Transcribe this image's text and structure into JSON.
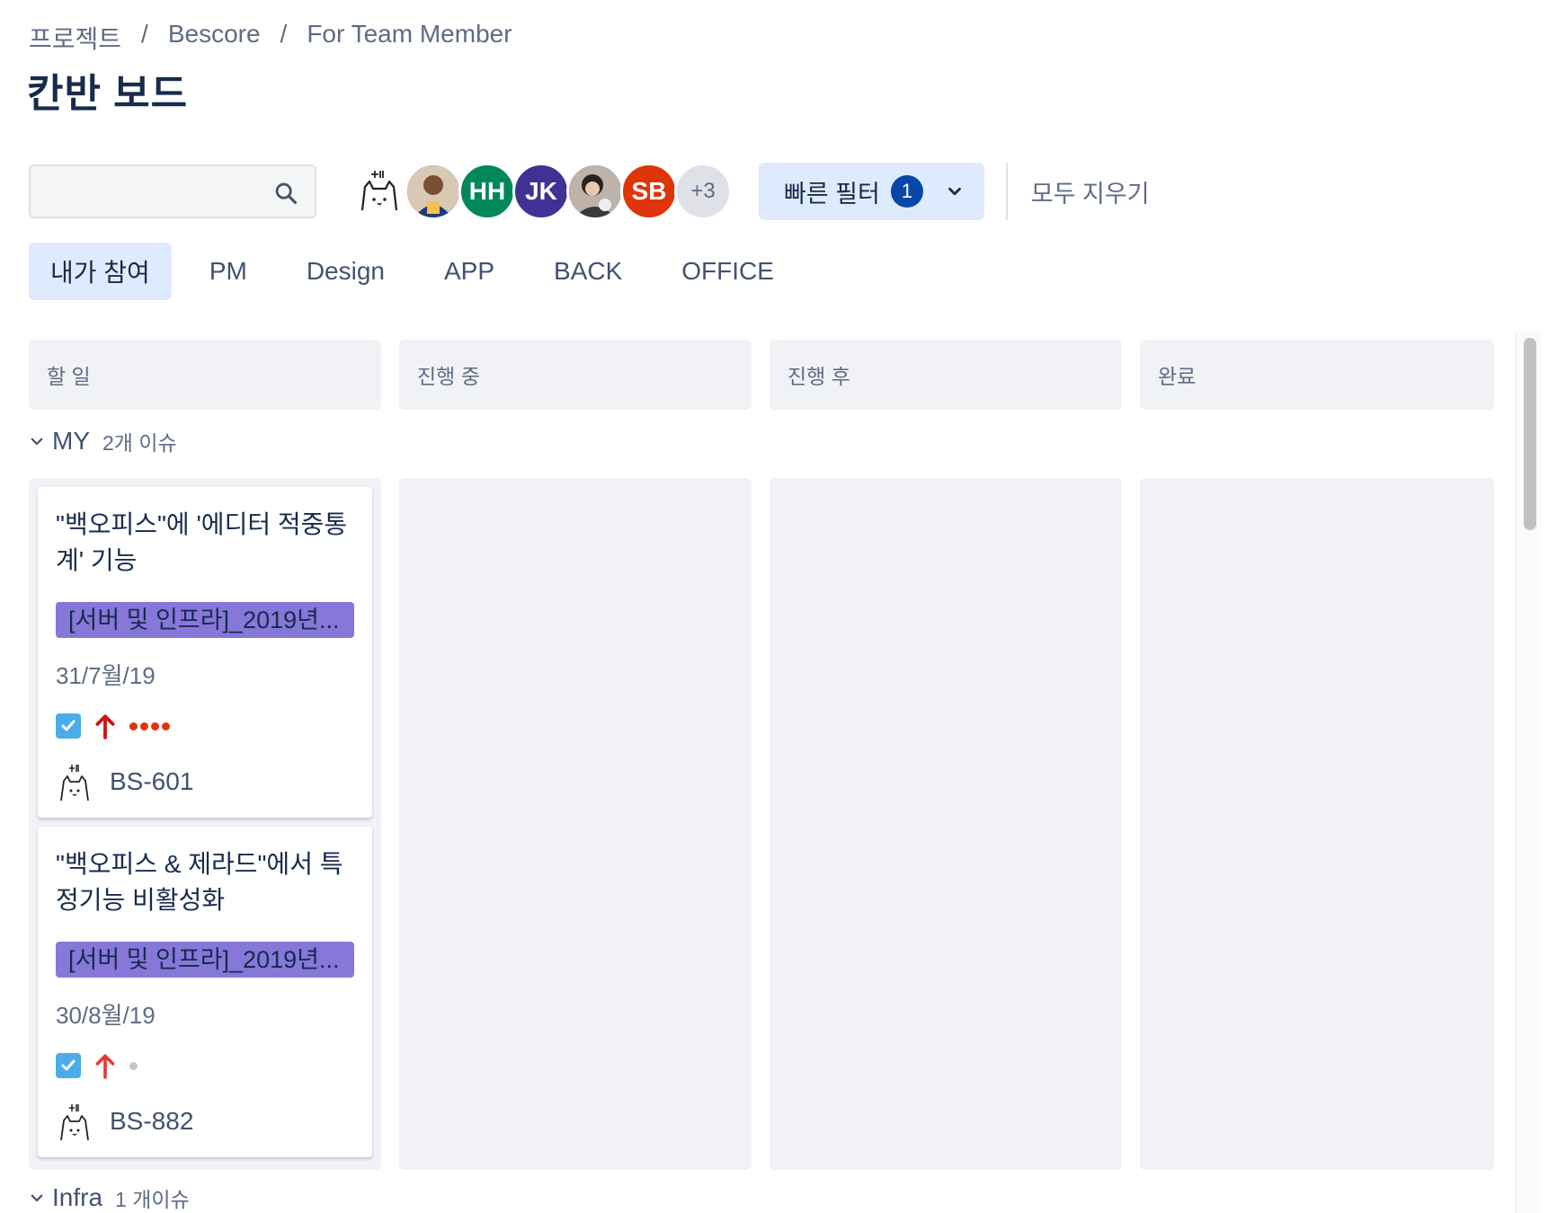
{
  "breadcrumb": {
    "items": [
      "프로젝트",
      "Bescore",
      "For Team Member"
    ],
    "separator": "/"
  },
  "page_title": "칸반 보드",
  "toolbar": {
    "search_placeholder": "",
    "avatars": [
      {
        "initials": "",
        "kind": "cat-doodle"
      },
      {
        "initials": "",
        "kind": "photo",
        "color": "#8a6d5b"
      },
      {
        "initials": "HH",
        "color": "#00875a"
      },
      {
        "initials": "JK",
        "color": "#403294"
      },
      {
        "initials": "",
        "kind": "photo",
        "color": "#5a4a44"
      },
      {
        "initials": "SB",
        "color": "#de350b"
      },
      {
        "initials": "+3",
        "color": "#dfe1e6"
      }
    ],
    "quick_filter_label": "빠른 필터",
    "quick_filter_count": "1",
    "clear_all_label": "모두 지우기"
  },
  "tabs": [
    {
      "label": "내가 참여",
      "active": true
    },
    {
      "label": "PM",
      "active": false
    },
    {
      "label": "Design",
      "active": false
    },
    {
      "label": "APP",
      "active": false
    },
    {
      "label": "BACK",
      "active": false
    },
    {
      "label": "OFFICE",
      "active": false
    }
  ],
  "columns": [
    "할 일",
    "진행 중",
    "진행 후",
    "완료"
  ],
  "swimlanes": [
    {
      "name": "MY",
      "count": "2개 이슈"
    },
    {
      "name": "Infra",
      "count": "1 개이슈"
    }
  ],
  "cards": [
    {
      "title": "\"백오피스\"에 '에디터 적중통계' 기능",
      "epic": "[서버 및 인프라]_2019년...",
      "due": "31/7월/19",
      "priority": "highest",
      "points_dots": 4,
      "key": "BS-601"
    },
    {
      "title": "\"백오피스 & 제라드\"에서 특정기능 비활성화",
      "epic": "[서버 및 인프라]_2019년...",
      "due": "30/8월/19",
      "priority": "high",
      "points_dots": 1,
      "key": "BS-882"
    }
  ],
  "colors": {
    "accent": "#deebff",
    "epic": "#8777d9",
    "task": "#4bade8",
    "priority": "#de350b"
  }
}
